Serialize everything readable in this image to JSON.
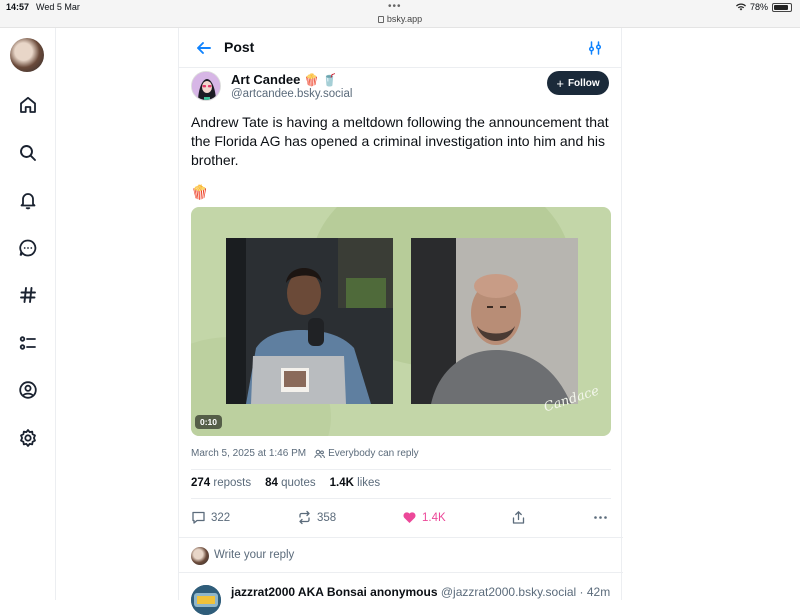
{
  "status_bar": {
    "time": "14:57",
    "date": "Wed 5 Mar",
    "url": "bsky.app",
    "battery": "78%",
    "dots": "•••"
  },
  "nav": {
    "items": [
      "home-icon",
      "search-icon",
      "bell-icon",
      "chat-icon",
      "hashtag-icon",
      "list-icon",
      "profile-icon",
      "settings-icon"
    ]
  },
  "header": {
    "title": "Post"
  },
  "post": {
    "author_name": "Art Candee",
    "author_emoji": "🍿 🥤",
    "author_handle": "@artcandee.bsky.social",
    "follow_label": "Follow",
    "text": "Andrew Tate is having a meltdown following the announcement that the Florida AG has opened a criminal investigation into him and his brother.",
    "emoji_line": "🍿",
    "video": {
      "duration": "0:10",
      "watermark": "Candace"
    },
    "timestamp": "March 5, 2025 at 1:46 PM",
    "reply_permission": "Everybody can reply",
    "stats": {
      "reposts_count": "274",
      "reposts_label": "reposts",
      "quotes_count": "84",
      "quotes_label": "quotes",
      "likes_count": "1.4K",
      "likes_label": "likes"
    },
    "actions": {
      "replies": "322",
      "reposts": "358",
      "likes": "1.4K"
    }
  },
  "reply_box": {
    "prompt": "Write your reply"
  },
  "next_post": {
    "author_name": "jazzrat2000 AKA Bonsai anonymous",
    "author_handle": "@jazzrat2000.bsky.social · 42m"
  },
  "colors": {
    "accent": "#1083fe",
    "like": "#ec4899",
    "follow_bg": "#1b2a3a",
    "video_bg": "#c3d6a8"
  }
}
